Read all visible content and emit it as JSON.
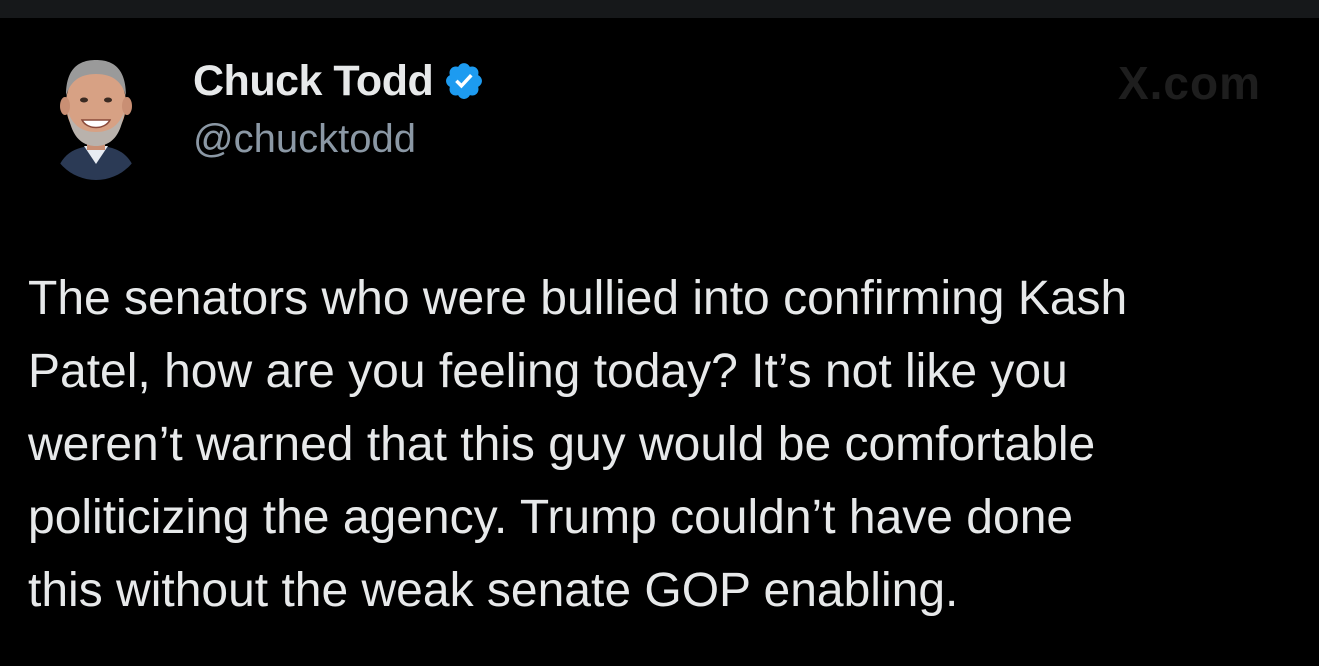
{
  "tweet": {
    "author": {
      "display_name": "Chuck Todd",
      "handle": "@chucktodd",
      "verified": true,
      "verified_icon": "verified-badge-icon",
      "avatar_icon": "avatar-photo"
    },
    "watermark": "X.com",
    "text": "The senators who were bullied into confirming Kash\nPatel, how are you feeling today?  It’s not like you\nweren’t warned that this guy would be comfortable\npoliticizing the agency.  Trump couldn’t have done\nthis without the weak senate GOP enabling."
  },
  "colors": {
    "background": "#000000",
    "text_primary": "#e7e9ea",
    "text_secondary": "#8b98a5",
    "verified_blue": "#1d9bf0"
  }
}
